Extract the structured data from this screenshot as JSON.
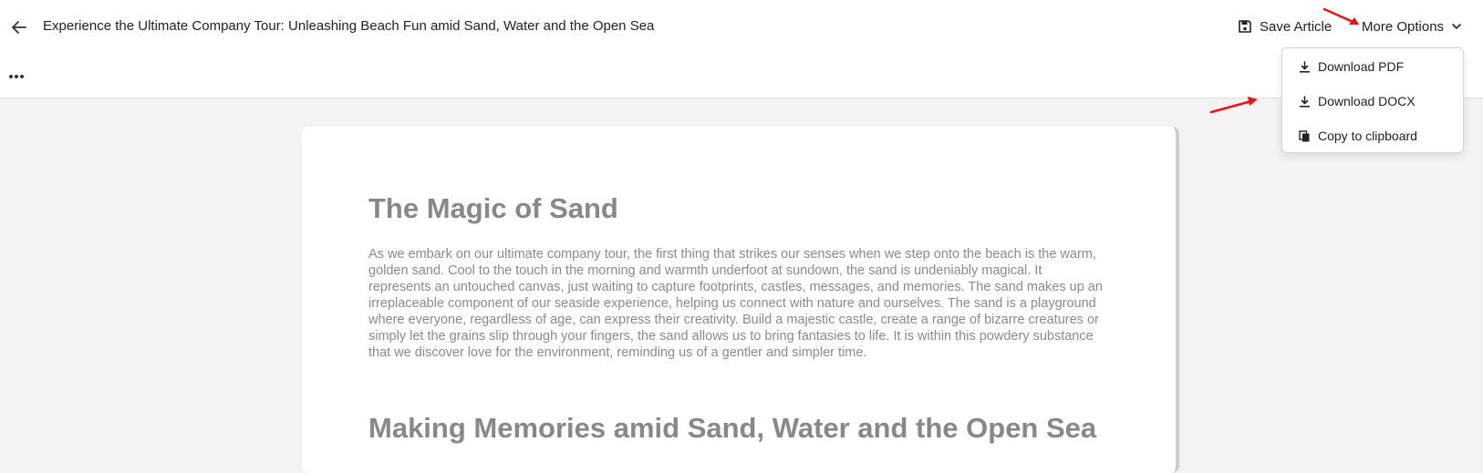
{
  "header": {
    "title": "Experience the Ultimate Company Tour: Unleashing Beach Fun amid Sand, Water and the Open Sea",
    "save_label": "Save Article",
    "more_label": "More Options"
  },
  "menu": {
    "items": [
      {
        "label": "Download PDF",
        "icon": "download-icon"
      },
      {
        "label": "Download DOCX",
        "icon": "download-icon"
      },
      {
        "label": "Copy to clipboard",
        "icon": "copy-icon"
      }
    ]
  },
  "article": {
    "heading1": "The Magic of Sand",
    "paragraph1": "As we embark on our ultimate company tour, the first thing that strikes our senses when we step onto the beach is the warm, golden sand. Cool to the touch in the morning and warmth underfoot at sundown, the sand is undeniably magical. It represents an untouched canvas, just waiting to capture footprints, castles, messages, and memories. The sand makes up an irreplaceable component of our seaside experience, helping us connect with nature and ourselves. The sand is a playground where everyone, regardless of age, can express their creativity. Build a majestic castle, create a range of bizarre creatures or simply let the grains slip through your fingers, the sand allows us to bring fantasies to life. It is within this powdery substance that we discover love for the environment, reminding us of a gentler and simpler time.",
    "heading2": "Making Memories amid Sand, Water and the Open Sea"
  },
  "colors": {
    "annotation_arrow": "#ee1111",
    "heading_text": "#888888",
    "body_text": "#8a8a8a",
    "page_background": "#f5f2f2"
  }
}
